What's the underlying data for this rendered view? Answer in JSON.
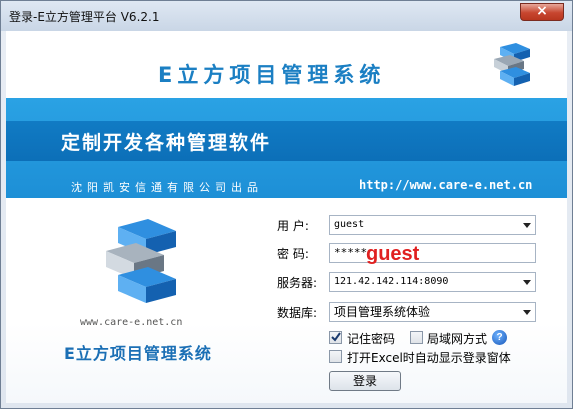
{
  "window": {
    "title": "登录-E立方管理平台 V6.2.1",
    "close_glyph": "×"
  },
  "header": {
    "title": "E立方项目管理系统"
  },
  "banner": {
    "slogan": "定制开发各种管理软件",
    "producer": "沈阳凯安信通有限公司出品",
    "site_url": "http://www.care-e.net.cn"
  },
  "logo_panel": {
    "url": "www.care-e.net.cn",
    "product_name": "E立方项目管理系统"
  },
  "form": {
    "user": {
      "label": "用  户:",
      "value": "guest"
    },
    "password": {
      "label": "密  码:",
      "value": "*****"
    },
    "server": {
      "label": "服务器:",
      "value": "121.42.142.114:8090"
    },
    "database": {
      "label": "数据库:",
      "value": "项目管理系统体验"
    },
    "remember_password": {
      "label": "记住密码",
      "checked": true
    },
    "lan_mode": {
      "label": "局域网方式",
      "checked": false
    },
    "open_excel": {
      "label": "打开Excel时自动显示登录窗体",
      "checked": false
    },
    "login_label": "登录"
  },
  "overlay": {
    "text": "guest",
    "color": "#e02020"
  },
  "colors": {
    "brand_blue": "#1b7fc3",
    "banner_blue": "#1d8fd6"
  }
}
